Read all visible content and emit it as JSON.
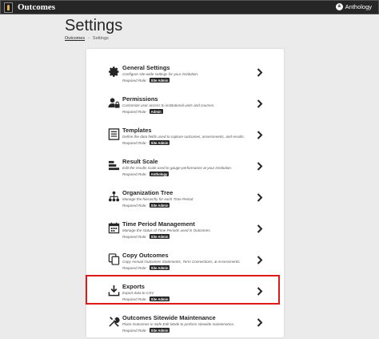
{
  "topbar": {
    "app_title": "Outcomes",
    "brand_label": "Anthology",
    "brand_icon": "anthology-logo-icon"
  },
  "page": {
    "title": "Settings"
  },
  "breadcrumb": {
    "root": "Outcomes",
    "separator": "›",
    "current": "Settings"
  },
  "colors": {
    "highlight": "#e01818",
    "topbar": "#262626",
    "badge": "#262626"
  },
  "settings": {
    "items": [
      {
        "title": "General Settings",
        "desc": "Configure site-wide settings for your institution.",
        "role_label": "Required Role:",
        "role": "Site Admin",
        "icon": "gear-icon"
      },
      {
        "title": "Permissions",
        "desc": "Customize user access to institutional units and courses.",
        "role_label": "Required Role:",
        "role": "Admin",
        "icon": "user-lock-icon"
      },
      {
        "title": "Templates",
        "desc": "Define the data fields used to capture outcomes, assessments, and results.",
        "role_label": "Required Role:",
        "role": "Site Admin",
        "icon": "template-icon"
      },
      {
        "title": "Result Scale",
        "desc": "Edit the results scale used to gauge performance at your institution.",
        "role_label": "Required Role:",
        "role": "Anthology",
        "icon": "scale-bars-icon"
      },
      {
        "title": "Organization Tree",
        "desc": "Manage the hierarchy for each Time Period",
        "role_label": "Required Role:",
        "role": "Site Admin",
        "icon": "org-tree-icon"
      },
      {
        "title": "Time Period Management",
        "desc": "Manage the status of Time Periods used in Outcomes.",
        "role_label": "Required Role:",
        "role": "Site Admin",
        "icon": "calendar-icon"
      },
      {
        "title": "Copy Outcomes",
        "desc": "Copy Annual Outcomes Statements, Term Connections, & Assessments.",
        "role_label": "Required Role:",
        "role": "Site Admin",
        "icon": "copy-icon"
      },
      {
        "title": "Exports",
        "desc": "Export data to CSV",
        "role_label": "Required Role:",
        "role": "Site Admin",
        "icon": "download-icon"
      },
      {
        "title": "Outcomes Sitewide Maintenance",
        "desc": "Place Outcomes in Safe Edit Mode to perform sitewide maintenance.",
        "role_label": "Required Role:",
        "role": "Site Admin",
        "icon": "tools-icon"
      }
    ]
  }
}
